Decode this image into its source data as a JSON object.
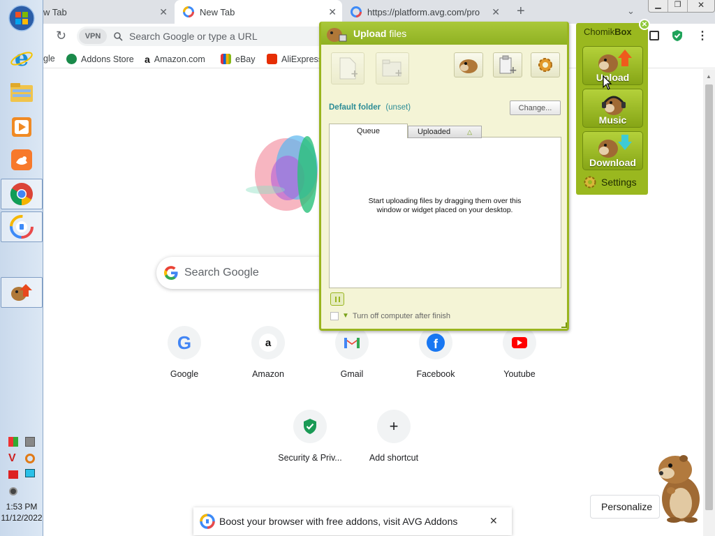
{
  "taskbar": {
    "clock_time": "1:53 PM",
    "clock_date": "11/12/2022",
    "icons": [
      "windows-start-icon",
      "internet-explorer-icon",
      "file-explorer-icon",
      "media-player-icon",
      "uc-browser-icon",
      "chrome-icon",
      "avg-browser-icon",
      "chomikbox-taskbar-icon"
    ]
  },
  "browser": {
    "tabs": [
      {
        "label": "w Tab"
      },
      {
        "label": "New Tab"
      },
      {
        "label": "https://platform.avg.com/pro"
      }
    ],
    "vpn_label": "VPN",
    "omnibox_placeholder": "Search Google or type a URL",
    "bookmarks": [
      {
        "label": "gle"
      },
      {
        "label": "Addons Store"
      },
      {
        "label": "Amazon.com"
      },
      {
        "label": "eBay"
      },
      {
        "label": "AliExpress"
      }
    ]
  },
  "newtab": {
    "search_placeholder": "Search Google",
    "shortcuts": [
      {
        "label": "Google"
      },
      {
        "label": "Amazon"
      },
      {
        "label": "Gmail"
      },
      {
        "label": "Facebook"
      },
      {
        "label": "Youtube"
      },
      {
        "label": "Security & Priv..."
      },
      {
        "label": "Add shortcut"
      }
    ],
    "personalize_label": "Personalize",
    "banner_text": "Boost your browser with free addons, visit AVG Addons"
  },
  "upload_window": {
    "title_bold": "Upload",
    "title_rest": " files",
    "default_folder_label": "Default folder",
    "default_folder_value": "(unset)",
    "change_button": "Change...",
    "tab_queue": "Queue",
    "tab_uploaded": "Uploaded",
    "empty_message": "Start uploading files by dragging them over this window or widget placed on your desktop.",
    "turn_off_label": "Turn off computer after finish",
    "accent_color": "#9ab51f"
  },
  "chomikbox": {
    "title_plain": "Chomik",
    "title_bold": "Box",
    "upload_label": "Upload",
    "music_label": "Music",
    "download_label": "Download",
    "settings_label": "Settings"
  }
}
